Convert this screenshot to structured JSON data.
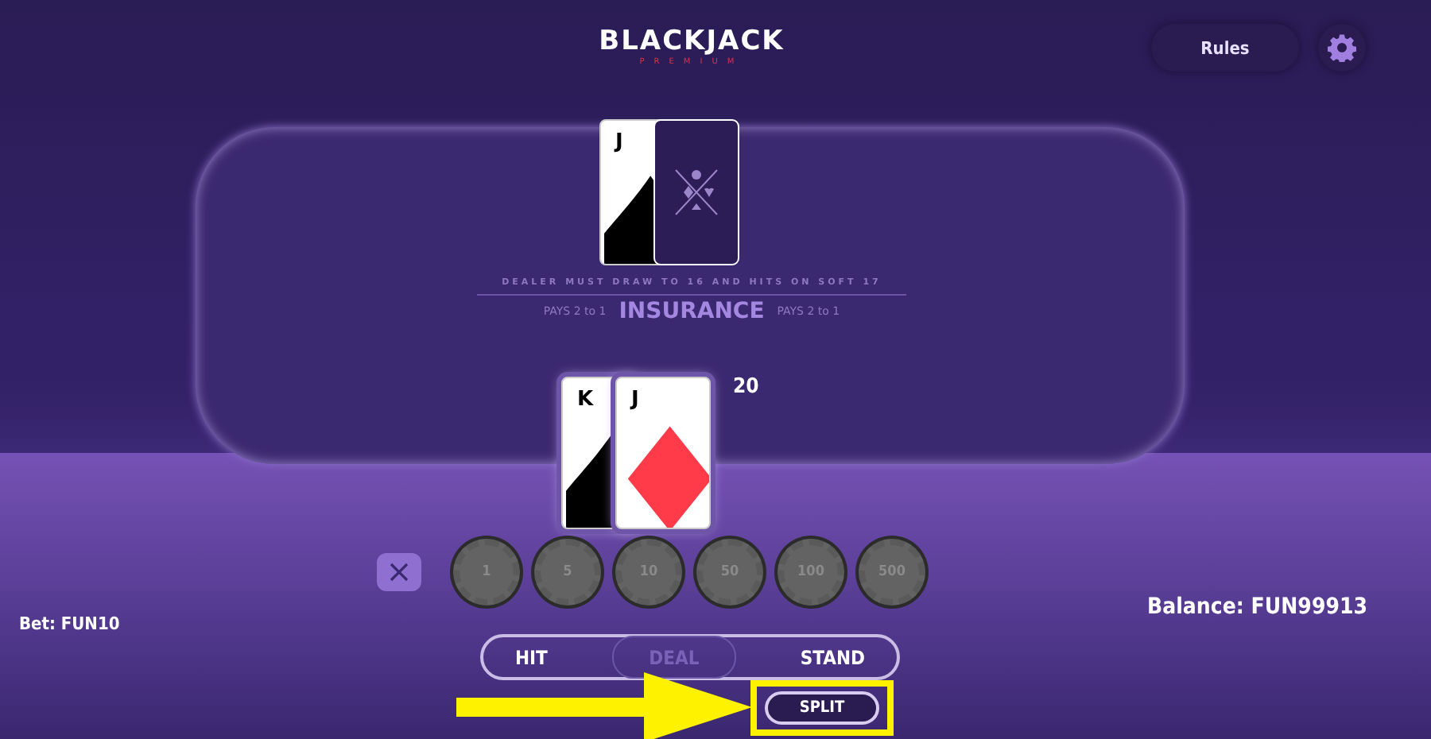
{
  "title": "BLACKJACK",
  "subtitle": "PREMIUM",
  "rules_button": "Rules",
  "dealer": {
    "cards": [
      {
        "rank": "J",
        "kind": "spade",
        "face_up": true
      },
      {
        "face_up": false
      }
    ]
  },
  "table_rule": "DEALER MUST DRAW TO 16 AND HITS ON SOFT 17",
  "insurance": {
    "label": "INSURANCE",
    "pays_left": "PAYS 2 to 1",
    "pays_right": "PAYS 2 to 1"
  },
  "player": {
    "cards": [
      {
        "rank": "K",
        "kind": "spade",
        "face_up": true
      },
      {
        "rank": "J",
        "kind": "diamond",
        "face_up": true
      }
    ],
    "total": "20"
  },
  "chips": [
    "1",
    "5",
    "10",
    "50",
    "100",
    "500"
  ],
  "bet": "Bet: FUN10",
  "balance": "Balance: FUN99913",
  "actions": [
    {
      "label": "HIT",
      "disabled": false
    },
    {
      "label": "DEAL",
      "disabled": true
    },
    {
      "label": "STAND",
      "disabled": false
    }
  ],
  "split": {
    "label": "SPLIT",
    "highlighted": true
  }
}
